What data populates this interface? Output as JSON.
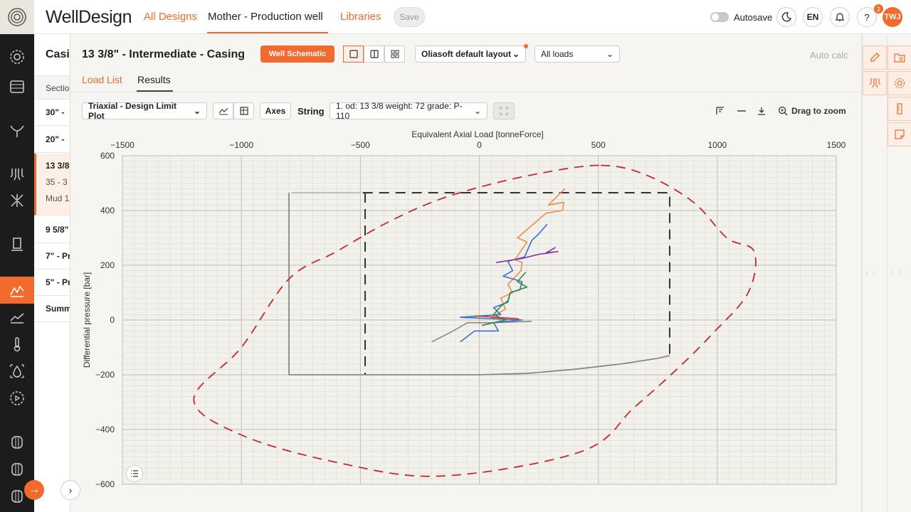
{
  "app": {
    "brand": "WellDesign",
    "nav": {
      "all_designs": "All Designs",
      "current": "Mother - Production well",
      "libraries": "Libraries"
    },
    "save_label": "Save",
    "autosave_label": "Autosave",
    "autosave_on": false,
    "language": "EN",
    "notifications_count": "2",
    "help_label": "?",
    "user_initials": "TWJ",
    "accent_color": "#f26a2e"
  },
  "sidebar": {
    "icons": [
      "settings-icon",
      "layers-icon",
      "trajectory-icon",
      "casing-icon",
      "formation-icon",
      "drillstring-icon",
      "load-analysis-icon",
      "results-chart-icon",
      "temperature-icon",
      "fluid-icon",
      "advanced-settings-icon",
      "well-a-icon",
      "well-b-icon",
      "well-c-icon"
    ],
    "active": "load-analysis-icon"
  },
  "left_panel": {
    "title": "Casi",
    "header": "Sectio",
    "items": [
      "30\" - ",
      "20\" - ",
      "9 5/8\"",
      "7\" - Pr",
      "5\" - Pr",
      "Summ"
    ],
    "selected": {
      "title": "13 3/8",
      "line1": "35 - 3",
      "line2": "Mud 1"
    }
  },
  "main": {
    "title": "13 3/8\" - Intermediate - Casing",
    "schematic_button": "Well Schematic",
    "layout_dropdown": "Oliasoft default layout",
    "loads_dropdown": "All loads",
    "auto_calc": "Auto calc",
    "tabs": {
      "load_list": "Load List",
      "results": "Results"
    },
    "active_tab": "Results",
    "plot_type": "Triaxial - Design Limit Plot",
    "axes_label": "Axes",
    "string_label": "String",
    "string_value": "1. od: 13 3/8 weight: 72 grade: P-110",
    "drag_to_zoom": "Drag to zoom"
  },
  "chart_data": {
    "type": "line",
    "xlabel": "Equivalent Axial Load [tonneForce]",
    "ylabel": "Differential pressure [bar]",
    "xlim": [
      -1500,
      1500
    ],
    "ylim": [
      -600,
      600
    ],
    "x_ticks": [
      -1500,
      -1000,
      -500,
      0,
      500,
      1000,
      1500
    ],
    "x_tick_labels": [
      "−1500",
      "−1000",
      "−500",
      "0",
      "500",
      "1000",
      "1500"
    ],
    "y_ticks": [
      600,
      400,
      200,
      0,
      -200,
      -400,
      -600
    ],
    "y_tick_labels": [
      "600",
      "400",
      "200",
      "0",
      "−200",
      "−400",
      "−600"
    ],
    "grid": true,
    "x_axis_position": "top",
    "series": [
      {
        "color": "#aaaaaa",
        "dash": "none",
        "width": 1.4,
        "points": [
          [
            -790,
            465
          ],
          [
            -500,
            465
          ]
        ]
      },
      {
        "color": "#333333",
        "dash": "14,9",
        "width": 2,
        "points": [
          [
            -490,
            465
          ],
          [
            800,
            465
          ],
          [
            800,
            -130
          ]
        ]
      },
      {
        "color": "#333333",
        "dash": "14,9",
        "width": 2,
        "points": [
          [
            -480,
            465
          ],
          [
            -480,
            -200
          ]
        ]
      },
      {
        "color": "#888888",
        "dash": "none",
        "width": 1.8,
        "points": [
          [
            -800,
            465
          ],
          [
            -800,
            -200
          ],
          [
            0,
            -200
          ],
          [
            200,
            -195
          ],
          [
            400,
            -180
          ],
          [
            600,
            -160
          ],
          [
            750,
            -140
          ],
          [
            800,
            -130
          ]
        ]
      },
      {
        "color": "#888888",
        "dash": "none",
        "width": 1.6,
        "points": [
          [
            -200,
            -80
          ],
          [
            -110,
            -40
          ],
          [
            -50,
            -10
          ],
          [
            50,
            -10
          ],
          [
            220,
            -5
          ]
        ]
      },
      {
        "color": "#f28b4a",
        "dash": "none",
        "width": 1.6,
        "points": [
          [
            360,
            480
          ],
          [
            290,
            420
          ],
          [
            355,
            430
          ],
          [
            350,
            400
          ],
          [
            280,
            390
          ],
          [
            160,
            300
          ],
          [
            200,
            285
          ],
          [
            150,
            220
          ],
          [
            180,
            210
          ],
          [
            175,
            180
          ],
          [
            120,
            130
          ],
          [
            140,
            100
          ],
          [
            90,
            80
          ],
          [
            110,
            40
          ],
          [
            50,
            10
          ],
          [
            120,
            0
          ]
        ]
      },
      {
        "color": "#3a6fd0",
        "dash": "none",
        "width": 1.6,
        "points": [
          [
            285,
            350
          ],
          [
            250,
            315
          ],
          [
            220,
            290
          ],
          [
            190,
            230
          ],
          [
            120,
            215
          ],
          [
            140,
            180
          ],
          [
            100,
            160
          ],
          [
            180,
            140
          ],
          [
            170,
            110
          ],
          [
            130,
            100
          ],
          [
            120,
            65
          ],
          [
            60,
            45
          ],
          [
            90,
            20
          ],
          [
            -80,
            10
          ],
          [
            180,
            0
          ],
          [
            60,
            -10
          ],
          [
            80,
            -40
          ],
          [
            -20,
            -40
          ],
          [
            -80,
            -80
          ]
        ]
      },
      {
        "color": "#2e8b3e",
        "dash": "none",
        "width": 1.6,
        "points": [
          [
            195,
            175
          ],
          [
            160,
            140
          ],
          [
            200,
            120
          ],
          [
            130,
            100
          ],
          [
            120,
            70
          ],
          [
            90,
            50
          ],
          [
            60,
            20
          ],
          [
            110,
            0
          ],
          [
            10,
            -20
          ]
        ]
      },
      {
        "color": "#8a2aa0",
        "dash": "none",
        "width": 1.6,
        "points": [
          [
            320,
            265
          ],
          [
            280,
            245
          ],
          [
            330,
            250
          ],
          [
            250,
            240
          ],
          [
            180,
            225
          ],
          [
            70,
            210
          ]
        ]
      },
      {
        "color": "#d33a2a",
        "dash": "none",
        "width": 1.6,
        "points": [
          [
            -20,
            15
          ],
          [
            160,
            5
          ],
          [
            170,
            0
          ]
        ]
      }
    ],
    "ellipse": {
      "color": "#c8282a",
      "points": [
        [
          510,
          565
        ],
        [
          700,
          530
        ],
        [
          900,
          430
        ],
        [
          1040,
          300
        ],
        [
          1155,
          250
        ],
        [
          1130,
          100
        ],
        [
          980,
          -50
        ],
        [
          830,
          -180
        ],
        [
          650,
          -320
        ],
        [
          430,
          -480
        ],
        [
          -160,
          -570
        ],
        [
          -600,
          -520
        ],
        [
          -1000,
          -420
        ],
        [
          -1200,
          -290
        ],
        [
          -1000,
          -100
        ],
        [
          -800,
          150
        ],
        [
          -600,
          250
        ],
        [
          -400,
          350
        ],
        [
          -200,
          430
        ],
        [
          0,
          485
        ],
        [
          250,
          535
        ],
        [
          510,
          565
        ]
      ]
    }
  },
  "right_panel": {
    "icons": [
      "edit-icon",
      "search-folder-icon",
      "stratigraphy-icon",
      "settings-icon",
      "ruler-icon",
      "note-icon"
    ]
  }
}
